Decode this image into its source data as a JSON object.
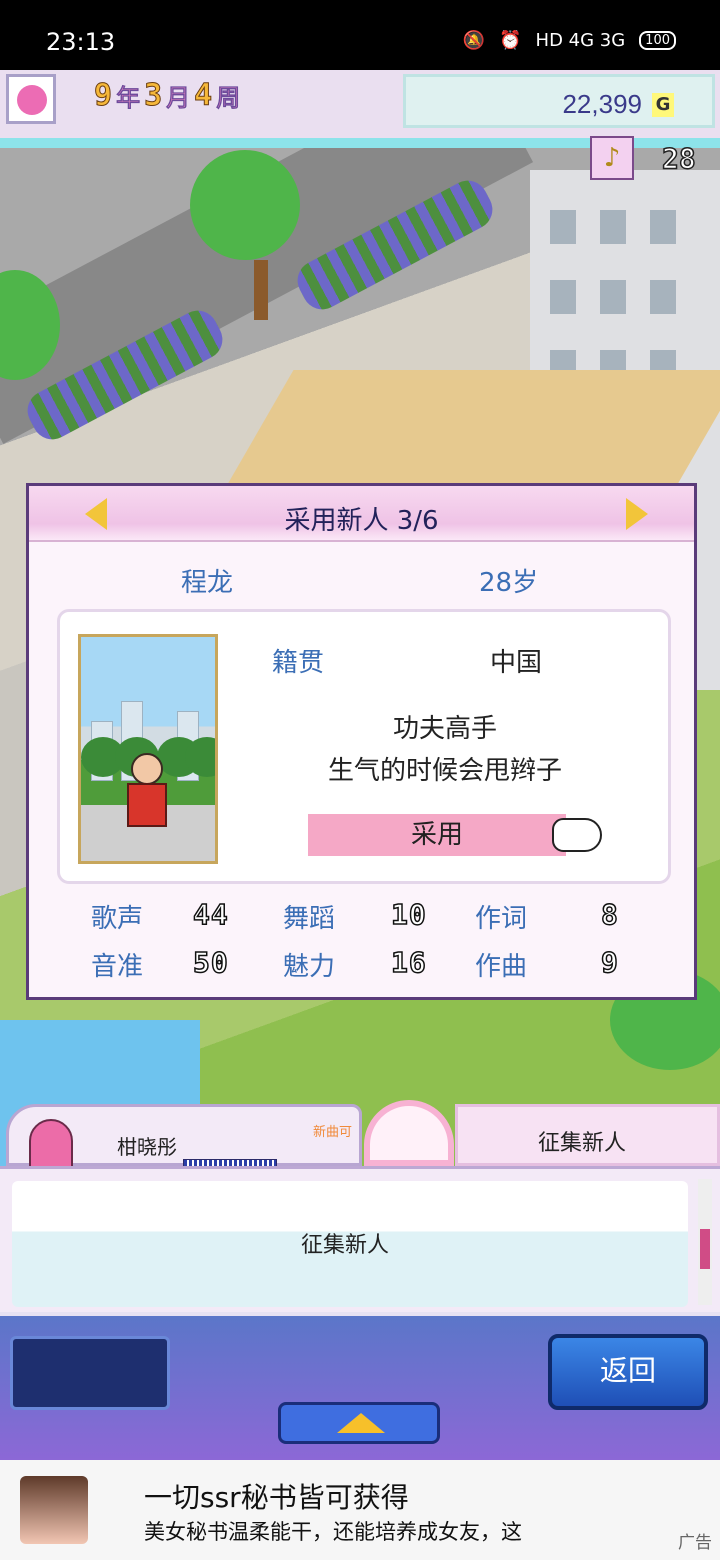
{
  "status_bar": {
    "time": "23:13",
    "indicators": "HD 4G 3G",
    "battery": "100"
  },
  "hud": {
    "date": {
      "year": "9",
      "year_unit": "年",
      "month": "3",
      "month_unit": "月",
      "week": "4",
      "week_unit": "周"
    },
    "money": "22,399",
    "currency": "G",
    "fans": "28"
  },
  "dialog": {
    "title": "采用新人 3/6",
    "name": "程龙",
    "age": "28岁",
    "hometown_label": "籍贯",
    "hometown_value": "中国",
    "description_line1": "功夫高手",
    "description_line2": "生气的时候会甩辫子",
    "hire_button": "采用",
    "stats": [
      {
        "label": "歌声",
        "value": "44"
      },
      {
        "label": "舞蹈",
        "value": "10"
      },
      {
        "label": "作词",
        "value": "8"
      },
      {
        "label": "音准",
        "value": "50"
      },
      {
        "label": "魅力",
        "value": "16"
      },
      {
        "label": "作曲",
        "value": "9"
      }
    ]
  },
  "tabs": {
    "character_name": "柑晓彤",
    "character_tag": "新曲可",
    "recruit_tab": "征集新人"
  },
  "message": "征集新人",
  "menu": {
    "back_button": "返回"
  },
  "ad": {
    "title": "一切ssr秘书皆可获得",
    "body": "美女秘书温柔能干，还能培养成女友，这",
    "tag": "广告"
  }
}
